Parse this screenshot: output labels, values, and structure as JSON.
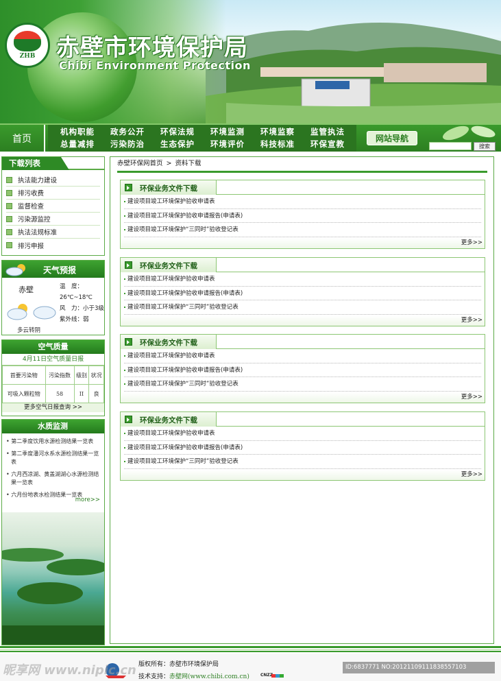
{
  "header": {
    "title": "赤壁市环境保护局",
    "subtitle": "Chibi Environment Protection",
    "emblem_text": "ZHB"
  },
  "nav": {
    "home": "首页",
    "items": [
      "机构职能",
      "政务公开",
      "环保法规",
      "环境监测",
      "环境监察",
      "监管执法",
      "总量减排",
      "污染防治",
      "生态保护",
      "环境评价",
      "科技标准",
      "环保宣教"
    ],
    "sitemap": "网站导航",
    "search_placeholder": "",
    "search_button": "搜索"
  },
  "sidebar": {
    "download": {
      "title": "下载列表",
      "items": [
        "执法能力建设",
        "排污收费",
        "监督检查",
        "污染源监控",
        "执法法规标准",
        "排污申报"
      ]
    },
    "weather": {
      "title": "天气预报",
      "city": "赤壁",
      "condition": "多云转阴",
      "temp_label": "温　度：",
      "temp_value": "26℃~18℃",
      "wind_label": "风　力：",
      "wind_value": "小于3级",
      "uv_label": "紫外线：",
      "uv_value": "弱"
    },
    "air": {
      "title": "空气质量",
      "date_title": "4月11日空气质量日报",
      "headers": [
        "首要污染物",
        "污染指数",
        "级别",
        "状况"
      ],
      "row": [
        "可吸入颗粒物",
        "58",
        "II",
        "良"
      ],
      "more": "更多空气日报查询 >>"
    },
    "water": {
      "title": "水质监测",
      "items": [
        "第二季度饮用水源检测结果一览表",
        "第二季度潘河水系水源检测结果一览表",
        "六月西凉湖、黄盖湖湖心水源检测结果一览表",
        "六月份地表水检测结果一览表"
      ],
      "more": "more>>"
    }
  },
  "main": {
    "breadcrumb": [
      "赤壁环保网首页",
      "资料下载"
    ],
    "breadcrumb_sep": ">",
    "panels": [
      {
        "title": "环保业务文件下载",
        "rows": [
          "建设项目竣工环境保护验收申请表",
          "建设项目竣工环境保护验收申请报告(申请表)",
          "建设项目竣工环境保护“三同时”验收登记表"
        ],
        "more": "更多>>"
      },
      {
        "title": "环保业务文件下载",
        "rows": [
          "建设项目竣工环境保护验收申请表",
          "建设项目竣工环境保护验收申请报告(申请表)",
          "建设项目竣工环境保护“三同时”验收登记表"
        ],
        "more": "更多>>"
      },
      {
        "title": "环保业务文件下载",
        "rows": [
          "建设项目竣工环境保护验收申请表",
          "建设项目竣工环境保护验收申请报告(申请表)",
          "建设项目竣工环境保护“三同时”验收登记表"
        ],
        "more": "更多>>"
      },
      {
        "title": "环保业务文件下载",
        "rows": [
          "建设项目竣工环境保护验收申请表",
          "建设项目竣工环境保护验收申请报告(申请表)",
          "建设项目竣工环境保护“三同时”验收登记表"
        ],
        "more": "更多>>"
      }
    ]
  },
  "footer": {
    "copyright": "版权所有：赤壁市环境保护局",
    "tech_label": "技术支持：",
    "tech_link": "赤壁网(www.chibi.com.cn)",
    "cnzz": "CNZZ"
  },
  "watermark": {
    "left": "昵享网 www.nipic.cn",
    "right": "ID:6837771 NO:20121109111838557103"
  }
}
